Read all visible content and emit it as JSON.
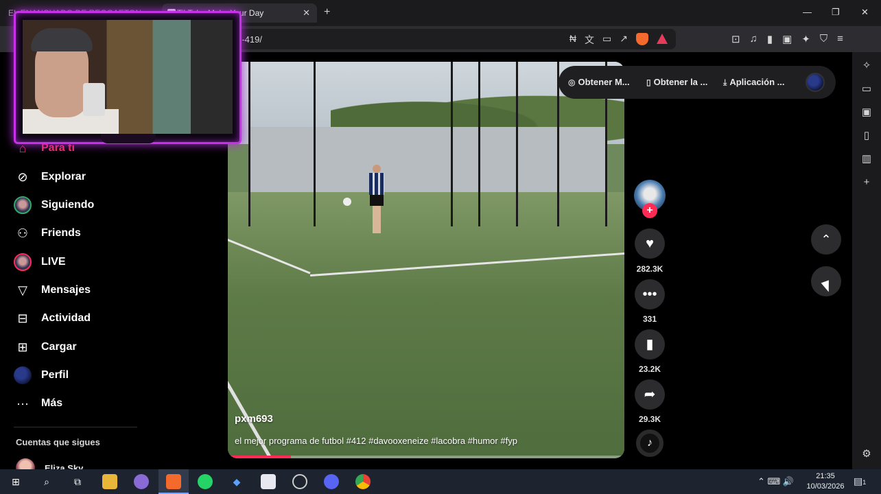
{
  "browser": {
    "tabs": [
      {
        "label": "EL ENANCHADO DE REGGAETON"
      },
      {
        "label": "TikTok - Make Your Day"
      }
    ],
    "tab_close": "✕",
    "new_tab": "+",
    "window_controls": {
      "minimize": "—",
      "maximize": "❐",
      "close": "✕"
    },
    "url": "/es-419/",
    "address_icons": [
      "translate-off-icon",
      "translate-icon",
      "cast-icon",
      "share-icon",
      "brave-shields-icon",
      "brave-rewards-icon"
    ],
    "toolbar_icons": [
      "screenshot-icon",
      "music-icon",
      "sidebar-icon",
      "wallet-icon",
      "leo-icon",
      "vpn-icon",
      "menu-icon"
    ]
  },
  "tiktok": {
    "nav": [
      {
        "label": "Para ti",
        "icon": "home-icon",
        "active": true
      },
      {
        "label": "Explorar",
        "icon": "compass-icon"
      },
      {
        "label": "Siguiendo",
        "icon": "following-avatar"
      },
      {
        "label": "Friends",
        "icon": "friends-icon"
      },
      {
        "label": "LIVE",
        "icon": "live-avatar"
      },
      {
        "label": "Mensajes",
        "icon": "send-icon"
      },
      {
        "label": "Actividad",
        "icon": "activity-icon"
      },
      {
        "label": "Cargar",
        "icon": "upload-icon"
      },
      {
        "label": "Perfil",
        "icon": "profile-avatar"
      },
      {
        "label": "Más",
        "icon": "more-icon"
      }
    ],
    "following_header": "Cuentas que sigues",
    "following_accounts": [
      {
        "name": "Eliza Sky"
      }
    ],
    "get_app": {
      "item1": "Obtener M...",
      "item2": "Obtener la ...",
      "item3": "Aplicación ..."
    },
    "video": {
      "author": "pxm693",
      "description": "el mejor programa de futbol #412 #davooxeneize #lacobra #humor #fyp",
      "progress": 0.16
    },
    "actions": {
      "follow": "+",
      "likes": "282.3K",
      "comments": "331",
      "saves": "23.2K",
      "shares": "29.3K"
    },
    "nav_arrows": {
      "up": "⌃",
      "down": "⌄"
    }
  },
  "taskbar": {
    "clock_time": "21:35",
    "clock_date": "10/03/2026",
    "notif_count": "1"
  },
  "colors": {
    "accent": "#fe2c55",
    "webcam_frame": "#c630e6",
    "taskbar": "#1d2430"
  }
}
